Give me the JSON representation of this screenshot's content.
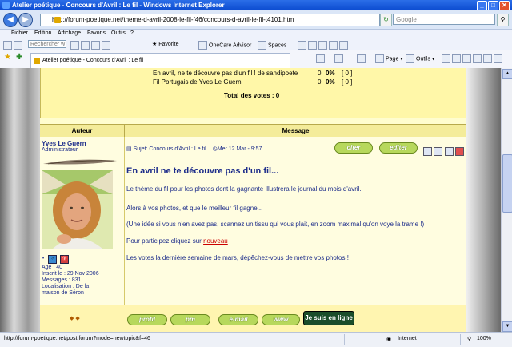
{
  "window": {
    "title": "Atelier poétique - Concours d'Avril : Le fil - Windows Internet Explorer",
    "minimize": "_",
    "maximize": "□",
    "close": "✕"
  },
  "address": {
    "url": "http://forum-poetique.net/theme-d-avril-2008-le-fil-f46/concours-d-avril-le-fil-t4101.htm",
    "search_placeholder": "Google",
    "refresh": "↻",
    "stop": "✕"
  },
  "menu": [
    "Fichier",
    "Edition",
    "Affichage",
    "Favoris",
    "Outils",
    "?"
  ],
  "links": {
    "search_placeholder": "Rechercher w",
    "favorite": "Favorite",
    "onecare": "OneCare Advisor",
    "spaces": "Spaces"
  },
  "tab": {
    "label": "Atelier poétique - Concours d'Avril : Le fil"
  },
  "commands": {
    "page": "Page",
    "tools": "Outils"
  },
  "poll": {
    "rows": [
      {
        "text": "En avril, ne te découvre pas d'un fil ! de sandipoete",
        "count": "0",
        "pct": "0%",
        "votes": "[ 0 ]"
      },
      {
        "text": "Fil Portugais de Yves Le Guern",
        "count": "0",
        "pct": "0%",
        "votes": "[ 0 ]"
      }
    ],
    "total": "Total des votes : 0"
  },
  "headers": {
    "author": "Auteur",
    "message": "Message"
  },
  "author": {
    "name": "Yves Le Guern",
    "role": "Administrateur",
    "age": "Age : 40",
    "joined": "Inscrit le : 29 Nov 2006",
    "messages": "Messages : 831",
    "location": "Localisation : De la",
    "location2": "maison de Séron"
  },
  "post": {
    "subject": "Sujet: Concours d'Avril : Le fil",
    "date": "Mer 12 Mar - 9:57",
    "buttons": {
      "quote": "citer",
      "edit": "editer"
    },
    "title": "En avril ne te découvre pas d'un fil...",
    "lines": [
      "Le thème du fil pour les photos dont la gagnante illustrera le journal du mois d'avril.",
      "Alors à vos photos, et que le meilleur fil gagne...",
      "(Une idée si vous n'en avez pas, scannez un tissu qui vous plait, en zoom maximal qu'on voye la trame !)",
      "Pour participez cliquez sur",
      "Les votes la dernière semaine de mars, dépêchez-vous de mettre vos photos !"
    ],
    "link": "nouveau"
  },
  "footer_buttons": {
    "profile": "profil",
    "pm": "pm",
    "email": "e-mail",
    "www": "www",
    "online": "Je suis en ligne"
  },
  "status": {
    "url": "http://forum-poetique.net/post.forum?mode=newtopic&f=46",
    "zone": "Internet",
    "zoom": "100%"
  }
}
